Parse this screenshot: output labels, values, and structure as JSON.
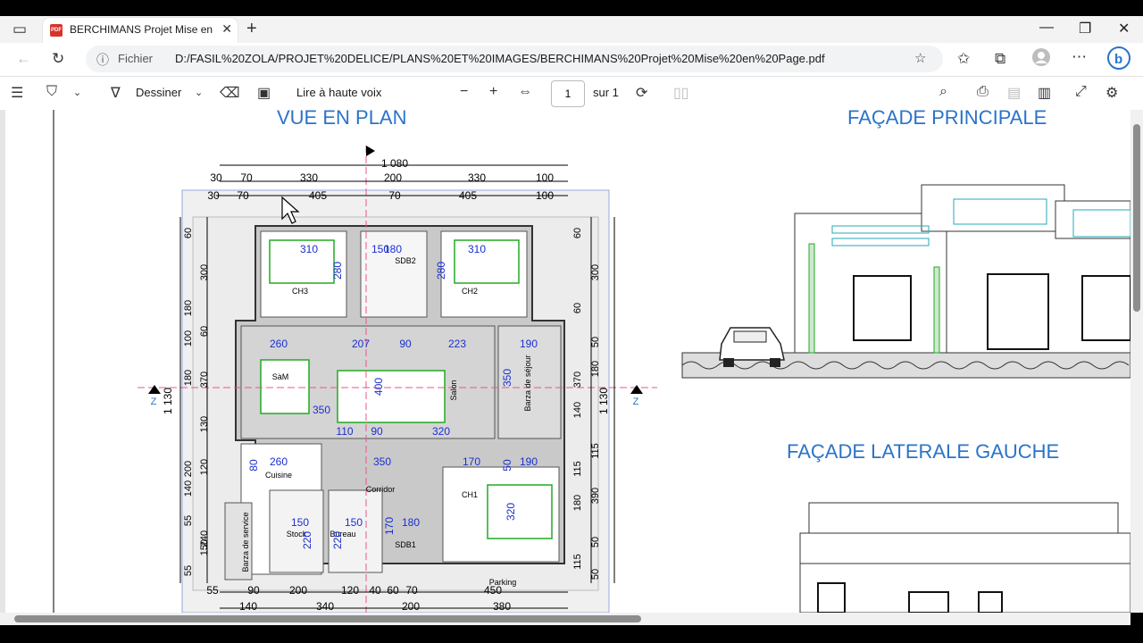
{
  "browser": {
    "tab_title": "BERCHIMANS Projet Mise en Page",
    "tab_favicon_label": "PDF",
    "address_scheme_label": "Fichier",
    "address_url": "D:/FASIL%20ZOLA/PROJET%20DELICE/PLANS%20ET%20IMAGES/BERCHIMANS%20Projet%20Mise%20en%20Page.pdf"
  },
  "pdf_toolbar": {
    "draw_label": "Dessiner",
    "read_aloud_label": "Lire à haute voix",
    "page_number": "1",
    "page_total": "sur 1"
  },
  "drawing": {
    "plan_title": "VUE EN PLAN",
    "facade_main_title": "FAÇADE PRINCIPALE",
    "facade_left_title": "FAÇADE LATERALE GAUCHE",
    "total_width": "1 080",
    "total_depth": "1 130",
    "top_dims_row1": [
      "30",
      "70",
      "330",
      "200",
      "330",
      "100"
    ],
    "top_dims_row2": [
      "30",
      "70",
      "405",
      "70",
      "405",
      "100"
    ],
    "bottom_dims_row1": [
      "55",
      "90",
      "200",
      "120",
      "40",
      "60",
      "70",
      "450"
    ],
    "bottom_dims_row2": [
      "140",
      "340",
      "200",
      "380"
    ],
    "left_dims": [
      "60",
      "300",
      "180",
      "60",
      "100",
      "370",
      "180",
      "130",
      "200",
      "120",
      "140",
      "240",
      "55",
      "150",
      "55"
    ],
    "right_dims": [
      "60",
      "300",
      "60",
      "50",
      "370",
      "180",
      "140",
      "115",
      "115",
      "390",
      "180",
      "50",
      "115",
      "50"
    ],
    "rooms": [
      "CH3",
      "SDB2",
      "CH2",
      "SàM",
      "Salon",
      "Barza de séjour",
      "Cuisine",
      "Corridor",
      "CH1",
      "Stock",
      "Bureau",
      "SDB1",
      "Barza de service",
      "Parking"
    ],
    "room_dims": [
      "310",
      "150",
      "180",
      "280",
      "310",
      "280",
      "260",
      "207",
      "90",
      "223",
      "190",
      "350",
      "400",
      "350",
      "110",
      "90",
      "320",
      "260",
      "80",
      "350",
      "170",
      "50",
      "190",
      "320",
      "150",
      "220",
      "150",
      "220",
      "170",
      "180"
    ],
    "section_marker": "Z"
  }
}
